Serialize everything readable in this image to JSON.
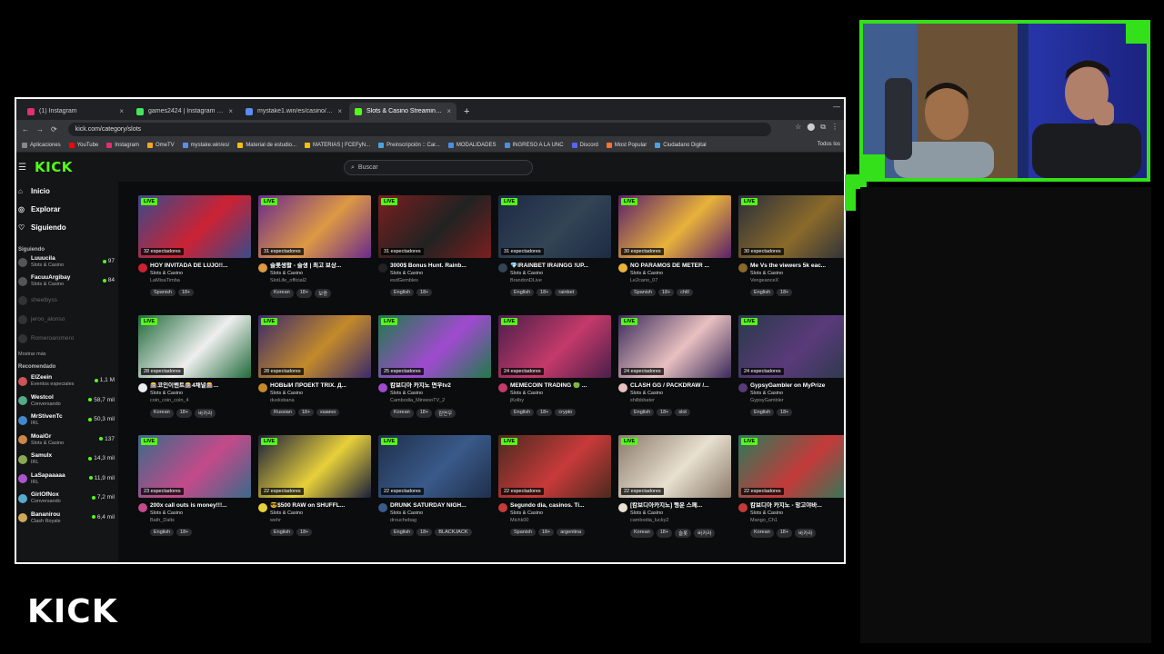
{
  "browser": {
    "tabs": [
      {
        "title": "(1) Instagram",
        "color": "#e1306c"
      },
      {
        "title": "games2424 | Instagram | Linktr...",
        "color": "#43e55e"
      },
      {
        "title": "mystake1.win/es/casino/casino",
        "color": "#5b8def"
      },
      {
        "title": "Slots & Casino Streaming - Live...",
        "color": "#53fc18"
      }
    ],
    "url": "kick.com/category/slots",
    "bookmarks": [
      {
        "label": "Aplicaciones",
        "color": "#888"
      },
      {
        "label": "YouTube",
        "color": "#ff0000"
      },
      {
        "label": "Instagram",
        "color": "#e1306c"
      },
      {
        "label": "OmeTV",
        "color": "#f5a623"
      },
      {
        "label": "mystake.win/es/",
        "color": "#5b8def"
      },
      {
        "label": "Material de estudio...",
        "color": "#f4c20d"
      },
      {
        "label": "MATERIAS | FCEFyN...",
        "color": "#f4c20d"
      },
      {
        "label": "Preinscripción :: Car...",
        "color": "#4aa3df"
      },
      {
        "label": "MODALIDADES",
        "color": "#4a90e2"
      },
      {
        "label": "INGRESO A LA UNC",
        "color": "#4a90e2"
      },
      {
        "label": "Discord",
        "color": "#5865f2"
      },
      {
        "label": "Most Popular",
        "color": "#ff7139"
      },
      {
        "label": "Ciudadano Digital",
        "color": "#4aa3df"
      }
    ],
    "bookmarks_right": "Todos los"
  },
  "kick": {
    "logo": "KICK",
    "search_placeholder": "Buscar",
    "nav": [
      {
        "label": "Inicio",
        "icon": "home-icon"
      },
      {
        "label": "Explorar",
        "icon": "compass-icon"
      },
      {
        "label": "Siguiendo",
        "icon": "heart-icon"
      }
    ],
    "following_title": "Siguiendo",
    "following": [
      {
        "name": "Luuucila",
        "category": "Slots & Casino",
        "viewers": "97",
        "live": true
      },
      {
        "name": "FacuuArgibay",
        "category": "Slots & Casino",
        "viewers": "84",
        "live": true
      },
      {
        "name": "sheelbyss",
        "category": "",
        "viewers": "",
        "live": false
      },
      {
        "name": "jeroo_alonso",
        "category": "",
        "viewers": "",
        "live": false
      },
      {
        "name": "Romeroaromero",
        "category": "",
        "viewers": "",
        "live": false
      }
    ],
    "show_more": "Mostrar más",
    "recommended_title": "Recomendado",
    "recommended": [
      {
        "name": "ElZeein",
        "category": "Eventos especiales",
        "viewers": "1,1 M"
      },
      {
        "name": "Westcol",
        "category": "Conversando",
        "viewers": "58,7 mil"
      },
      {
        "name": "MrStivenTc",
        "category": "IRL",
        "viewers": "50,3 mil"
      },
      {
        "name": "MoaiGr",
        "category": "Slots & Casino",
        "viewers": "137"
      },
      {
        "name": "Samulx",
        "category": "IRL",
        "viewers": "14,3 mil"
      },
      {
        "name": "LaSapaaaaa",
        "category": "IRL",
        "viewers": "11,9 mil"
      },
      {
        "name": "GirlOfNox",
        "category": "Conversando",
        "viewers": "7,2 mil"
      },
      {
        "name": "Bananirou",
        "category": "Clash Royale",
        "viewers": "6,4 mil"
      }
    ],
    "live_label": "LIVE",
    "streams": [
      {
        "title": "HOY INVITADA DE LUJO!!...",
        "category": "Slots & Casino",
        "user": "LaMisaTimba",
        "viewers": "32 espectadores",
        "tags": [
          "Spanish",
          "18+"
        ],
        "thumb": "#3a4a8a",
        "accent": "#c23"
      },
      {
        "title": "슬롯생활 - 슬생 | 최고 보상...",
        "category": "Slots & Casino",
        "user": "SlotLife_official2",
        "viewers": "31 espectadores",
        "tags": [
          "Korean",
          "18+",
          "보증"
        ],
        "thumb": "#6a2a8a",
        "accent": "#d94"
      },
      {
        "title": "3000$ Bonus Hunt. Rainb...",
        "category": "Slots & Casino",
        "user": "esdGembles",
        "viewers": "31 espectadores",
        "tags": [
          "English",
          "18+"
        ],
        "thumb": "#7a1f1f",
        "accent": "#222"
      },
      {
        "title": "💎IRAINBET IRAINGG !UP...",
        "category": "Slots & Casino",
        "user": "BrandonDLive",
        "viewers": "31 espectadores",
        "tags": [
          "English",
          "18+",
          "rainbet"
        ],
        "thumb": "#1d2a44",
        "accent": "#345"
      },
      {
        "title": "NO PARAMOS DE METER ...",
        "category": "Slots & Casino",
        "user": "Le2cano_07",
        "viewers": "30 espectadores",
        "tags": [
          "Spanish",
          "18+",
          "chill"
        ],
        "thumb": "#5a1f6a",
        "accent": "#e8b23a"
      },
      {
        "title": "Me Vs the viewers 5k eac...",
        "category": "Slots & Casino",
        "user": "VengeanceX",
        "viewers": "30 espectadores",
        "tags": [
          "English",
          "18+"
        ],
        "thumb": "#2a2f3a",
        "accent": "#8a6a2a"
      },
      {
        "title": "🎰코인이벤트🎰4채널🎰...",
        "category": "Slots & Casino",
        "user": "coin_coin_coin_4",
        "viewers": "28 espectadores",
        "tags": [
          "Korean",
          "18+",
          "바카라"
        ],
        "thumb": "#1f6a3a",
        "accent": "#eee"
      },
      {
        "title": "НОВЫЙ ПРОЕКТ TRIX. Д...",
        "category": "Slots & Casino",
        "user": "duxksbana",
        "viewers": "28 espectadores",
        "tags": [
          "Russian",
          "18+",
          "казино"
        ],
        "thumb": "#3a2a6a",
        "accent": "#c48a2a"
      },
      {
        "title": "캄보디아 카지노 면우tv2",
        "category": "Slots & Casino",
        "user": "Cambodia_MinwooTV_2",
        "viewers": "25 espectadores",
        "tags": [
          "Korean",
          "18+",
          "캄면우"
        ],
        "thumb": "#1f7a4a",
        "accent": "#a04ad0"
      },
      {
        "title": "MEMECOIN TRADING 🟢 ...",
        "category": "Slots & Casino",
        "user": "jKolby",
        "viewers": "24 espectadores",
        "tags": [
          "English",
          "18+",
          "crypto"
        ],
        "thumb": "#4a1f4a",
        "accent": "#c43a6a"
      },
      {
        "title": "CLASH GG / PACKDRAW /...",
        "category": "Slots & Casino",
        "user": "shilbbbater",
        "viewers": "24 espectadores",
        "tags": [
          "English",
          "18+",
          "slot"
        ],
        "thumb": "#3a2a5a",
        "accent": "#e8c0c0"
      },
      {
        "title": "GypsyGambler on MyPrize",
        "category": "Slots & Casino",
        "user": "GypsyGambler",
        "viewers": "24 espectadores",
        "tags": [
          "English",
          "18+"
        ],
        "thumb": "#2a3a4a",
        "accent": "#5a3a7a"
      },
      {
        "title": "200x call outs is money!!!...",
        "category": "Slots & Casino",
        "user": "Bath_Dalts",
        "viewers": "23 espectadores",
        "tags": [
          "English",
          "18+"
        ],
        "thumb": "#3a6a8a",
        "accent": "#c44a8a"
      },
      {
        "title": "😎$500 RAW on SHUFFL...",
        "category": "Slots & Casino",
        "user": "wehr",
        "viewers": "22 espectadores",
        "tags": [
          "English",
          "18+"
        ],
        "thumb": "#1a1f3a",
        "accent": "#e8d03a"
      },
      {
        "title": "DRUNK SATURDAY NIGH...",
        "category": "Slots & Casino",
        "user": "drouchebag",
        "viewers": "22 espectadores",
        "tags": [
          "English",
          "18+",
          "BLACKJACK"
        ],
        "thumb": "#1f2f4a",
        "accent": "#3a5a8a"
      },
      {
        "title": "Segundo dia, casinos. Ti...",
        "category": "Slots & Casino",
        "user": "Michk00",
        "viewers": "22 espectadores",
        "tags": [
          "Spanish",
          "18+",
          "argentina"
        ],
        "thumb": "#4a2a1f",
        "accent": "#c83a3a"
      },
      {
        "title": "[캄보디아카지노] 행운 스페...",
        "category": "Slots & Casino",
        "user": "cambodia_lucky2",
        "viewers": "22 espectadores",
        "tags": [
          "Korean",
          "18+",
          "슬롯",
          "바카라"
        ],
        "thumb": "#8a7a6a",
        "accent": "#e8e0d0"
      },
      {
        "title": "캄보디아 카지노 - 망고야바...",
        "category": "Slots & Casino",
        "user": "Mango_Ch1",
        "viewers": "22 espectadores",
        "tags": [
          "Korean",
          "18+",
          "바카라"
        ],
        "thumb": "#2a7a5a",
        "accent": "#c43a3a"
      }
    ]
  },
  "overlay_logo": "KICK",
  "colors": {
    "brand": "#53fc18",
    "cam_border": "#33e01a"
  }
}
